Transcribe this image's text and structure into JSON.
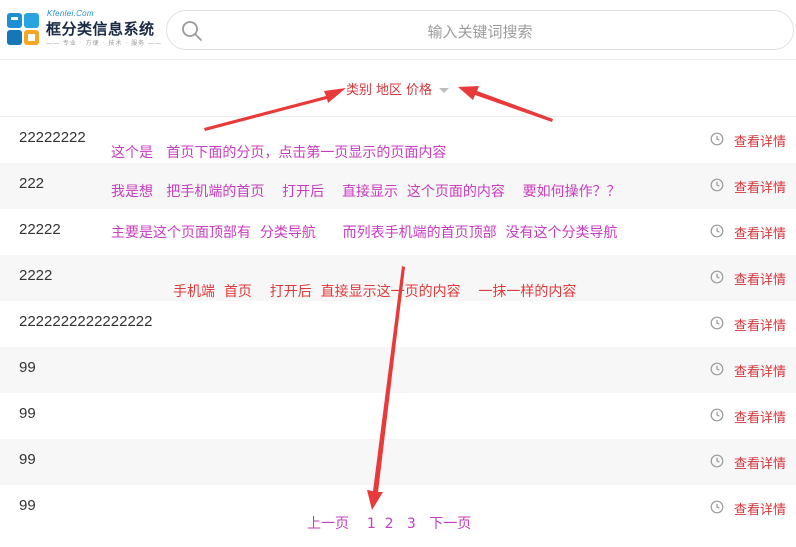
{
  "header": {
    "logo_domain": "Kfenlei.Com",
    "logo_title": "框分类信息系统",
    "logo_slogan": "—— 专业 · 方便 · 技术 · 服务 ——",
    "search_placeholder": "输入关键词搜索"
  },
  "filter": {
    "items": [
      "类别",
      "地区",
      "价格"
    ]
  },
  "list": {
    "detail_label": "查看详情",
    "rows": [
      {
        "title": "22222222"
      },
      {
        "title": "222"
      },
      {
        "title": "22222"
      },
      {
        "title": "2222"
      },
      {
        "title": "2222222222222222"
      },
      {
        "title": "99"
      },
      {
        "title": "99"
      },
      {
        "title": "99"
      },
      {
        "title": "99"
      }
    ]
  },
  "annotations": {
    "note1": "这个是   首页下面的分页，点击第一页显示的页面内容",
    "note2": "我是想   把手机端的首页    打开后    直接显示  这个页面的内容    要如何操作？？",
    "note3": "主要是这个页面顶部有  分类导航      而列表手机端的首页顶部  没有这个分类导航",
    "note4": "手机端  首页    打开后  直接显示这一页的内容    一抹一样的内容"
  },
  "pager": {
    "prev": "上一页",
    "pages": [
      "1",
      "2",
      "3"
    ],
    "next": "下一页"
  },
  "colors": {
    "accent_red": "#d6353b",
    "annotation_magenta": "#c83cc0",
    "arrow_red": "#e83a3a",
    "logo_blue": "#1e8fd2",
    "logo_orange": "#f5a623"
  }
}
